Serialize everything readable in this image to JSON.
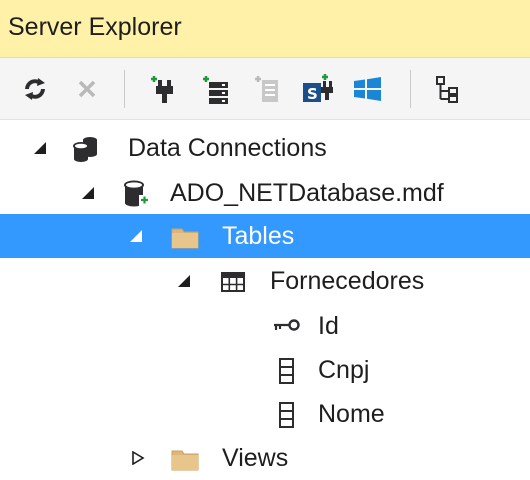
{
  "window": {
    "title": "Server Explorer"
  },
  "toolbar": {
    "buttons": [
      {
        "name": "refresh-icon"
      },
      {
        "name": "stop-icon"
      },
      {
        "name": "connect-to-database-icon"
      },
      {
        "name": "connect-to-server-icon"
      },
      {
        "name": "connect-to-sharepoint-icon"
      },
      {
        "name": "connect-to-azure-icon"
      },
      {
        "name": "windows-azure-icon"
      },
      {
        "name": "class-diagram-icon"
      }
    ]
  },
  "tree": {
    "data_connections": "Data Connections",
    "database": "ADO_NETDatabase.mdf",
    "tables": "Tables",
    "table_fornecedores": "Fornecedores",
    "columns": [
      "Id",
      "Cnpj",
      "Nome"
    ],
    "views": "Views"
  },
  "colors": {
    "title_bar_bg": "#fff1a8",
    "toolbar_bg": "#f5f5f5",
    "selection_bg": "#3399ff",
    "folder": "#dcb67a",
    "accent_green": "#1e9a3c",
    "accent_blue": "#1c86d6"
  }
}
